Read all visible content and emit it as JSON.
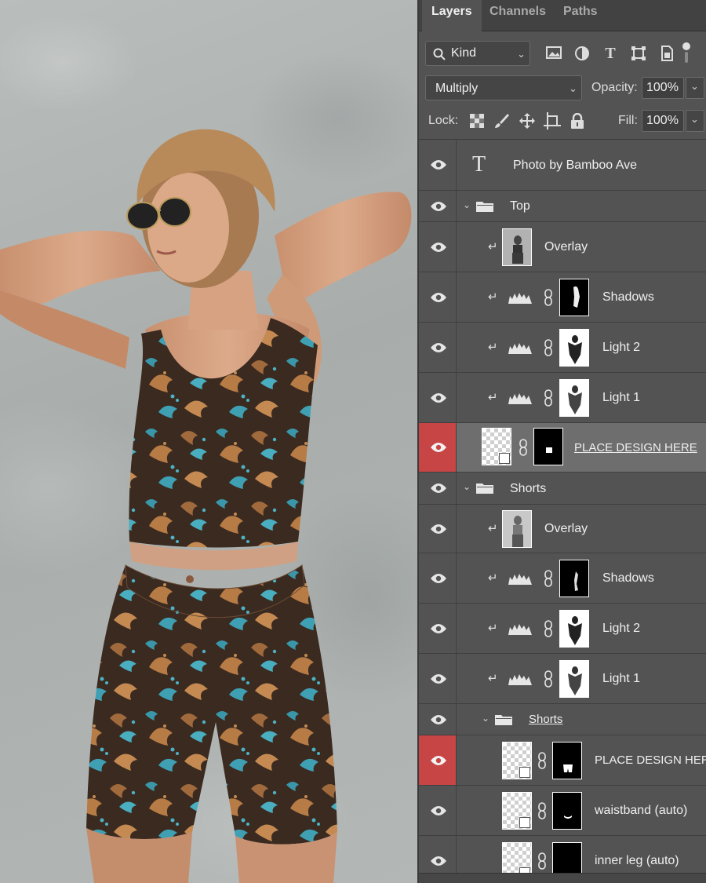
{
  "panel": {
    "tabs": [
      {
        "label": "Layers",
        "active": true
      },
      {
        "label": "Channels",
        "active": false
      },
      {
        "label": "Paths",
        "active": false
      }
    ],
    "filter": {
      "label": "Kind",
      "icons": [
        "image-filter-icon",
        "adjustment-filter-icon",
        "type-filter-icon",
        "shape-filter-icon",
        "smart-object-filter-icon"
      ]
    },
    "blend_mode": "Multiply",
    "opacity_label": "Opacity:",
    "opacity_value": "100%",
    "lock_label": "Lock:",
    "lock_icons": [
      "lock-transparent-icon",
      "lock-image-icon",
      "lock-position-icon",
      "lock-artboard-icon",
      "lock-all-icon"
    ],
    "fill_label": "Fill:",
    "fill_value": "100%"
  },
  "layers": [
    {
      "name": "Photo by Bamboo Ave",
      "kind": "text"
    },
    {
      "name": "Top",
      "kind": "group"
    },
    {
      "name": "Overlay",
      "kind": "pixel"
    },
    {
      "name": "Shadows",
      "kind": "adjustment"
    },
    {
      "name": "Light 2",
      "kind": "adjustment"
    },
    {
      "name": "Light 1",
      "kind": "adjustment"
    },
    {
      "name": "PLACE DESIGN HERE",
      "kind": "smart-object",
      "selected": true
    },
    {
      "name": "Shorts",
      "kind": "group"
    },
    {
      "name": "Overlay",
      "kind": "pixel"
    },
    {
      "name": "Shadows",
      "kind": "adjustment"
    },
    {
      "name": "Light 2",
      "kind": "adjustment"
    },
    {
      "name": "Light 1",
      "kind": "adjustment"
    },
    {
      "name": "Shorts",
      "kind": "group"
    },
    {
      "name": "PLACE DESIGN HERE",
      "kind": "smart-object"
    },
    {
      "name": "waistband (auto)",
      "kind": "smart-object"
    },
    {
      "name": "inner leg (auto)",
      "kind": "smart-object"
    }
  ],
  "colors": {
    "panel_bg": "#535353",
    "selected_row": "#6e6e6e",
    "eye_highlight": "#c84546",
    "tab_bar": "#424242"
  }
}
